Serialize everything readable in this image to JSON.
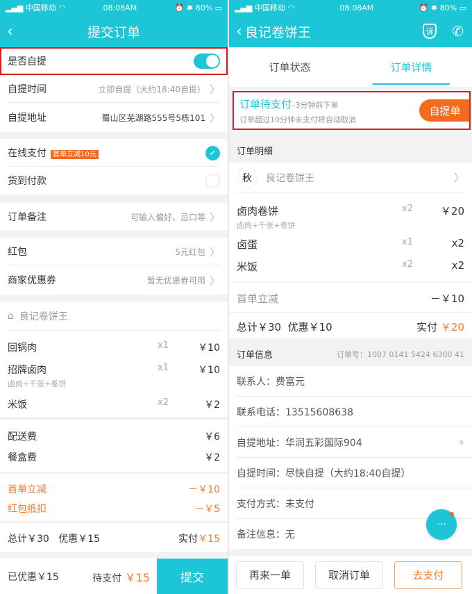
{
  "status": {
    "carrier": "中国移动",
    "time": "08:08AM",
    "battery": "80%"
  },
  "left": {
    "title": "提交订单",
    "self_pickup": {
      "label": "是否自提",
      "enabled": true
    },
    "pickup_time": {
      "label": "自提时间",
      "value": "立即自提（大约18:40自提）"
    },
    "pickup_address": {
      "label": "自提地址",
      "value": "蜀山区芜湖路555号5栋101"
    },
    "online_pay": {
      "label": "在线支付",
      "badge": "首单立减10元",
      "selected": true
    },
    "cod": {
      "label": "货到付款",
      "selected": false
    },
    "remark": {
      "label": "订单备注",
      "placeholder": "可输入偏好、忌口等"
    },
    "red_packet": {
      "label": "红包",
      "value": "5元红包"
    },
    "coupon": {
      "label": "商家优惠券",
      "value": "暂无优惠券可用"
    },
    "store": "良记卷饼王",
    "items": [
      {
        "name": "回锅肉",
        "qty": "x1",
        "price": "￥10"
      },
      {
        "name": "招牌卤肉",
        "sub": "卤肉+千张+卷饼",
        "qty": "x1",
        "price": "￥10"
      },
      {
        "name": "米饭",
        "qty": "x2",
        "price": "￥2"
      }
    ],
    "fees": [
      {
        "name": "配送费",
        "price": "￥6"
      },
      {
        "name": "餐盒费",
        "price": "￥2"
      }
    ],
    "discounts": [
      {
        "name": "首单立减",
        "price": "－￥10"
      },
      {
        "name": "红包抵扣",
        "price": "－￥5"
      }
    ],
    "total": "总计￥30",
    "saved": "优惠￥15",
    "paid_label": "实付",
    "paid": "￥15",
    "bottom": {
      "discounted": "已优惠￥15",
      "pending_label": "待支付",
      "pending": "￥15",
      "submit": "提交"
    }
  },
  "right": {
    "title": "良记卷饼王",
    "complain_icon_text": "诉",
    "tabs": [
      "订单状态",
      "订单详情"
    ],
    "banner": {
      "status": "订单待支付",
      "time": "–3分钟前下单",
      "note": "订单超过10分钟未支付将自动取消",
      "tag": "自提单"
    },
    "detail_header": "订单明细",
    "store": "良记卷饼王",
    "items": [
      {
        "name": "卤肉卷饼",
        "sub": "卤肉+千张+卷饼",
        "qty": "x2",
        "price": "￥20"
      },
      {
        "name": "卤蛋",
        "qty": "x1",
        "price": "x2"
      },
      {
        "name": "米饭",
        "qty": "x2",
        "price": "x2"
      }
    ],
    "discount": {
      "name": "首单立减",
      "price": "－￥10"
    },
    "total": "总计￥30",
    "saved": "优惠￥10",
    "paid_label": "实付",
    "paid": "￥20",
    "info_header": "订单信息",
    "order_no": "订单号：1007 0141 5424 6300 41",
    "info": [
      "联系人：费富元",
      "联系电话：13515608638",
      "自提地址：华润五彩国际904",
      "自提时间：尽快自提（大约18:40自提）",
      "支付方式：未支付",
      "备注信息：无"
    ],
    "buttons": {
      "reorder": "再来一单",
      "cancel": "取消订单",
      "pay": "去支付"
    }
  },
  "colors": {
    "brand": "#1cc6d6",
    "accent": "#f47a2e",
    "highlight": "#d81e1e"
  }
}
